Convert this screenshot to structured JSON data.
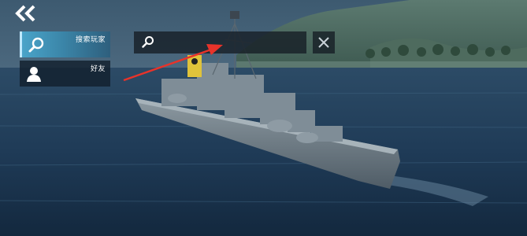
{
  "sidebar": {
    "items": [
      {
        "label": "搜索玩家",
        "icon": "search-icon",
        "active": true
      },
      {
        "label": "好友",
        "icon": "person-icon",
        "active": false
      }
    ]
  },
  "search": {
    "value": "",
    "placeholder": ""
  },
  "colors": {
    "active_tab": "#3b8fb5",
    "panel": "#14202d",
    "arrow": "#e8332a"
  }
}
